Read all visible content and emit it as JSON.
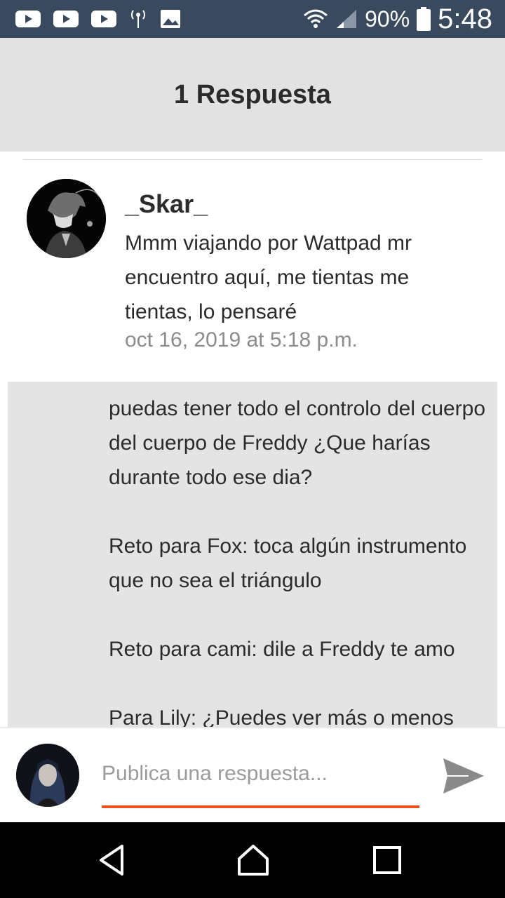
{
  "status_bar": {
    "left_icons": [
      "youtube-icon",
      "youtube-icon",
      "youtube-icon",
      "hotspot-icon",
      "image-icon"
    ],
    "battery_percent": "90%",
    "time": "5:48"
  },
  "header": {
    "title": "1 Respuesta"
  },
  "comment": {
    "author": "_Skar_",
    "text": "Mmm viajando por Wattpad mr encuentro aquí, me tientas me tientas, lo pensaré",
    "date": "oct 16, 2019 at 5:18 p.m."
  },
  "quoted_post": {
    "paragraphs": [
      "puedas tener todo el controlo del cuerpo del cuerpo de Freddy ¿Que harías durante todo ese dia?",
      "Reto para Fox: toca algún instrumento que no sea el triángulo",
      "Reto para cami: dile a Freddy te amo",
      "Para Lily: ¿Puedes ver más o menos"
    ]
  },
  "reply": {
    "placeholder": "Publica una respuesta..."
  },
  "colors": {
    "status_bar": "#3a4a5e",
    "header_bg": "#e2e2e2",
    "quote_bg": "#e4e4e4",
    "accent_underline": "#e8561e",
    "send_icon": "#8a8a8a"
  }
}
